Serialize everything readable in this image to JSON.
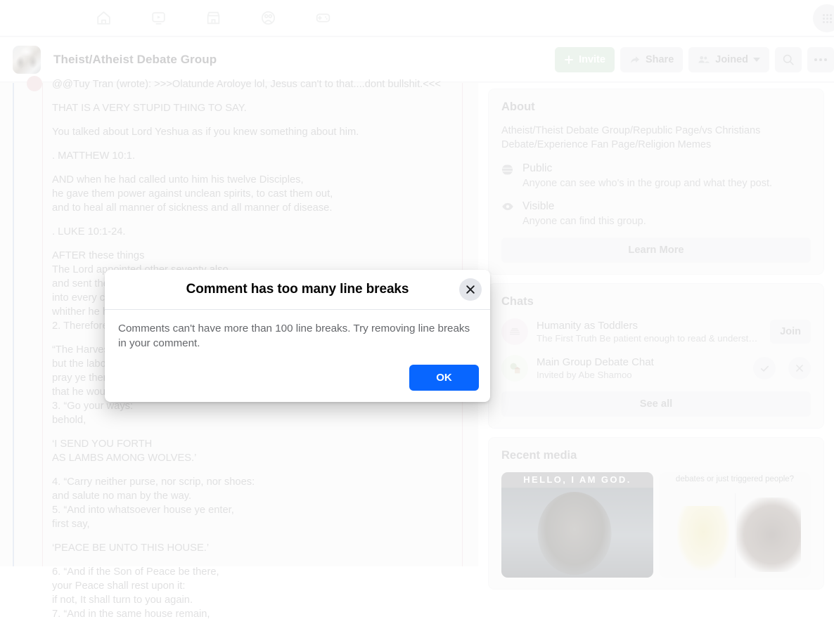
{
  "topnav": {
    "items": [
      {
        "name": "home-icon",
        "label": "Home"
      },
      {
        "name": "video-icon",
        "label": "Video"
      },
      {
        "name": "marketplace-icon",
        "label": "Marketplace"
      },
      {
        "name": "groups-icon",
        "label": "Groups"
      },
      {
        "name": "gaming-icon",
        "label": "Gaming"
      }
    ],
    "menu_label": "Menu"
  },
  "group_header": {
    "title": "Theist/Atheist Debate Group",
    "buttons": {
      "invite": "Invite",
      "share": "Share",
      "joined": "Joined",
      "search": "Search",
      "more": "More"
    }
  },
  "post": {
    "paragraphs": [
      "@@Tuy Tran (wrote): >>>Olatunde Aroloye lol, Jesus can't to that....dont bullshit.<<<",
      "THAT IS A VERY STUPID THING TO SAY.",
      "You talked about Lord Yeshua as if you knew something about him.",
      ". MATTHEW 10:1.",
      "AND when he had called unto him his twelve Disciples,\nhe gave them power against unclean spirits, to cast them out,\nand to heal all manner of sickness and all manner of disease.",
      ". LUKE 10:1-24.",
      "AFTER these things\nThe Lord appointed other seventy also,\nand sent them two and two before his face\ninto every city and place,\nwhither he himself would come.\n2. Therefore said he unto them,",
      "“The Harvest truly is great,\nbut the labourers are few:\npray ye therefore the Lord of the Harvest,\nthat he would send forth labourers into his Harvest.\n3. “Go your ways:\nbehold,",
      "‘I SEND YOU FORTH\nAS LAMBS AMONG WOLVES.’",
      "4. “Carry neither purse, nor scrip, nor shoes:\nand salute no man by the way.\n5. “And into whatsoever house ye enter,\nfirst say,",
      "‘PEACE BE UNTO THIS HOUSE.’",
      "6. “And if the Son of Peace be there,\nyour Peace shall rest upon it:\nif not, It shall turn to you again.\n7. “And in the same house remain,"
    ]
  },
  "about": {
    "heading": "About",
    "description": "Atheist/Theist Debate Group/Republic Page/vs Christians Debate/Experience Fan Page/Religion Memes",
    "rows": [
      {
        "icon": "globe-icon",
        "title": "Public",
        "detail": "Anyone can see who's in the group and what they post."
      },
      {
        "icon": "eye-icon",
        "title": "Visible",
        "detail": "Anyone can find this group."
      }
    ],
    "learn_more": "Learn More"
  },
  "chats": {
    "heading": "Chats",
    "items": [
      {
        "name": "Humanity as Toddlers",
        "subtitle": "The First Truth Be patient enough to read & understand …",
        "action": "Join",
        "avatar": "books-icon"
      },
      {
        "name": "Main Group Debate Chat",
        "subtitle": "Invited by Abe Shamoo",
        "accept": "Accept",
        "decline": "Decline",
        "avatar": "tree-house-icon"
      }
    ],
    "see_all": "See all"
  },
  "recent_media": {
    "heading": "Recent media",
    "items": [
      {
        "caption": "HELLO, I AM GOD."
      },
      {
        "caption": "debates or just triggered people?"
      }
    ]
  },
  "modal": {
    "title": "Comment has too many line breaks",
    "message": "Comments can't have more than 100 line breaks. Try removing line breaks in your comment.",
    "ok_label": "OK",
    "close_label": "Close",
    "accent_color": "#0866ff"
  }
}
